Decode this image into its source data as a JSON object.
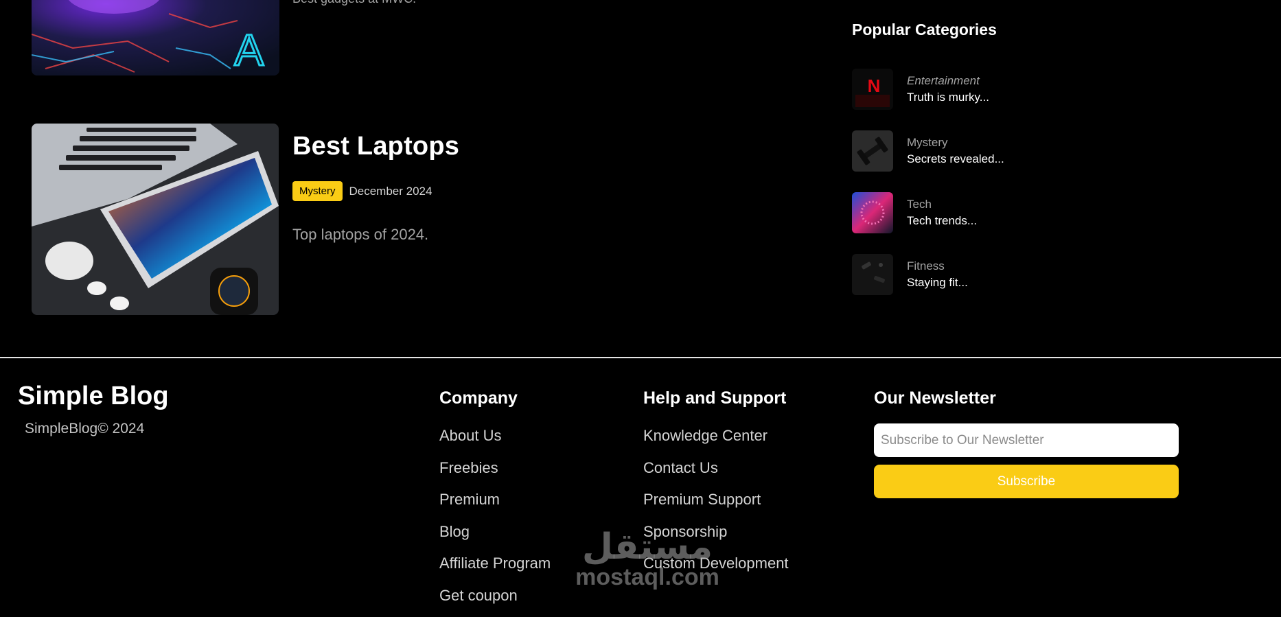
{
  "posts": [
    {
      "excerpt": "Best gadgets at MWC."
    },
    {
      "title": "Best Laptops",
      "category": "Mystery",
      "date": "December 2024",
      "excerpt": "Top laptops of 2024."
    }
  ],
  "sidebar": {
    "title": "Popular Categories",
    "categories": [
      {
        "name": "Entertainment",
        "teaser": "Truth is murky..."
      },
      {
        "name": "Mystery",
        "teaser": "Secrets revealed..."
      },
      {
        "name": "Tech",
        "teaser": "Tech trends..."
      },
      {
        "name": "Fitness",
        "teaser": "Staying fit..."
      }
    ]
  },
  "footer": {
    "brand": "Simple Blog",
    "copyright": "SimpleBlog© 2024",
    "company": {
      "title": "Company",
      "links": [
        "About Us",
        "Freebies",
        "Premium",
        "Blog",
        "Affiliate Program",
        "Get coupon"
      ]
    },
    "help": {
      "title": "Help and Support",
      "links": [
        "Knowledge Center",
        "Contact Us",
        "Premium Support",
        "Sponsorship",
        "Custom Development"
      ]
    },
    "newsletter": {
      "title": "Our Newsletter",
      "placeholder": "Subscribe to Our Newsletter",
      "button": "Subscribe"
    }
  },
  "watermark": {
    "arabic": "مستقل",
    "latin": "mostaql.com"
  },
  "colors": {
    "accent": "#facc15",
    "background": "#000000",
    "divider": "#e5e5e5"
  }
}
